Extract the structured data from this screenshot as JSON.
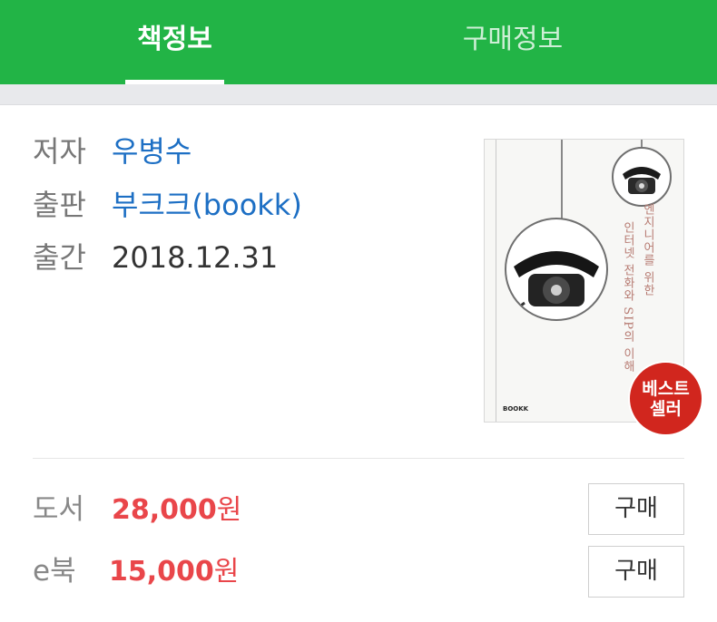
{
  "tabs": [
    {
      "label": "책정보",
      "active": true
    },
    {
      "label": "구매정보",
      "active": false
    }
  ],
  "book_info": {
    "author_label": "저자",
    "author": "우병수",
    "publisher_label": "출판",
    "publisher": "부크크(bookk)",
    "date_label": "출간",
    "date": "2018.12.31"
  },
  "cover": {
    "title_line1": "엔지니어를 위한",
    "title_line2": "인터넷 전화와 SIP의 이해",
    "publisher_mark": "BOOKK"
  },
  "badge": {
    "line1": "베스트",
    "line2": "셀러"
  },
  "prices": [
    {
      "label": "도서",
      "amount": "28,000",
      "unit": "원",
      "button": "구매"
    },
    {
      "label": "e북",
      "amount": "15,000",
      "unit": "원",
      "button": "구매"
    }
  ],
  "colors": {
    "header_green": "#22b446",
    "link_blue": "#1d6fc4",
    "price_red": "#e9464a",
    "badge_red": "#d1261e"
  },
  "icons": {
    "cover_illustration": "rotary-phone-icon"
  }
}
